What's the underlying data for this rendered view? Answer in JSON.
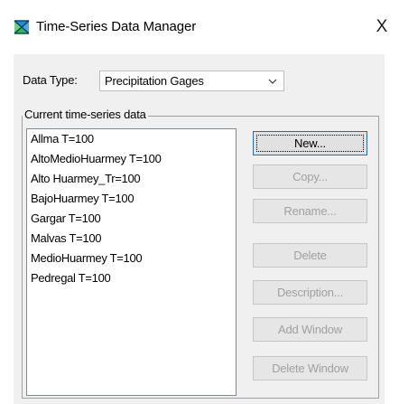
{
  "window": {
    "title": "Time-Series Data Manager",
    "close_glyph": "X",
    "app_icon": "hec-hms-icon"
  },
  "data_type": {
    "label": "Data Type:",
    "selected": "Precipitation Gages",
    "arrow_icon": "chevron-down-icon"
  },
  "group": {
    "title": "Current time-series data"
  },
  "list": {
    "items": [
      "Allma T=100",
      "AltoMedioHuarmey T=100",
      "Alto Huarmey_Tr=100",
      "BajoHuarmey T=100",
      "Gargar T=100",
      "Malvas T=100",
      "MedioHuarmey T=100",
      "Pedregal T=100"
    ]
  },
  "buttons": {
    "new": "New...",
    "copy": "Copy...",
    "rename": "Rename...",
    "delete": "Delete",
    "description": "Description...",
    "add_window": "Add Window",
    "delete_window": "Delete Window"
  },
  "colors": {
    "dialog_bg": "#f0f0f0",
    "disabled_text": "#a0a0a0",
    "focus_border": "#0078d7"
  }
}
